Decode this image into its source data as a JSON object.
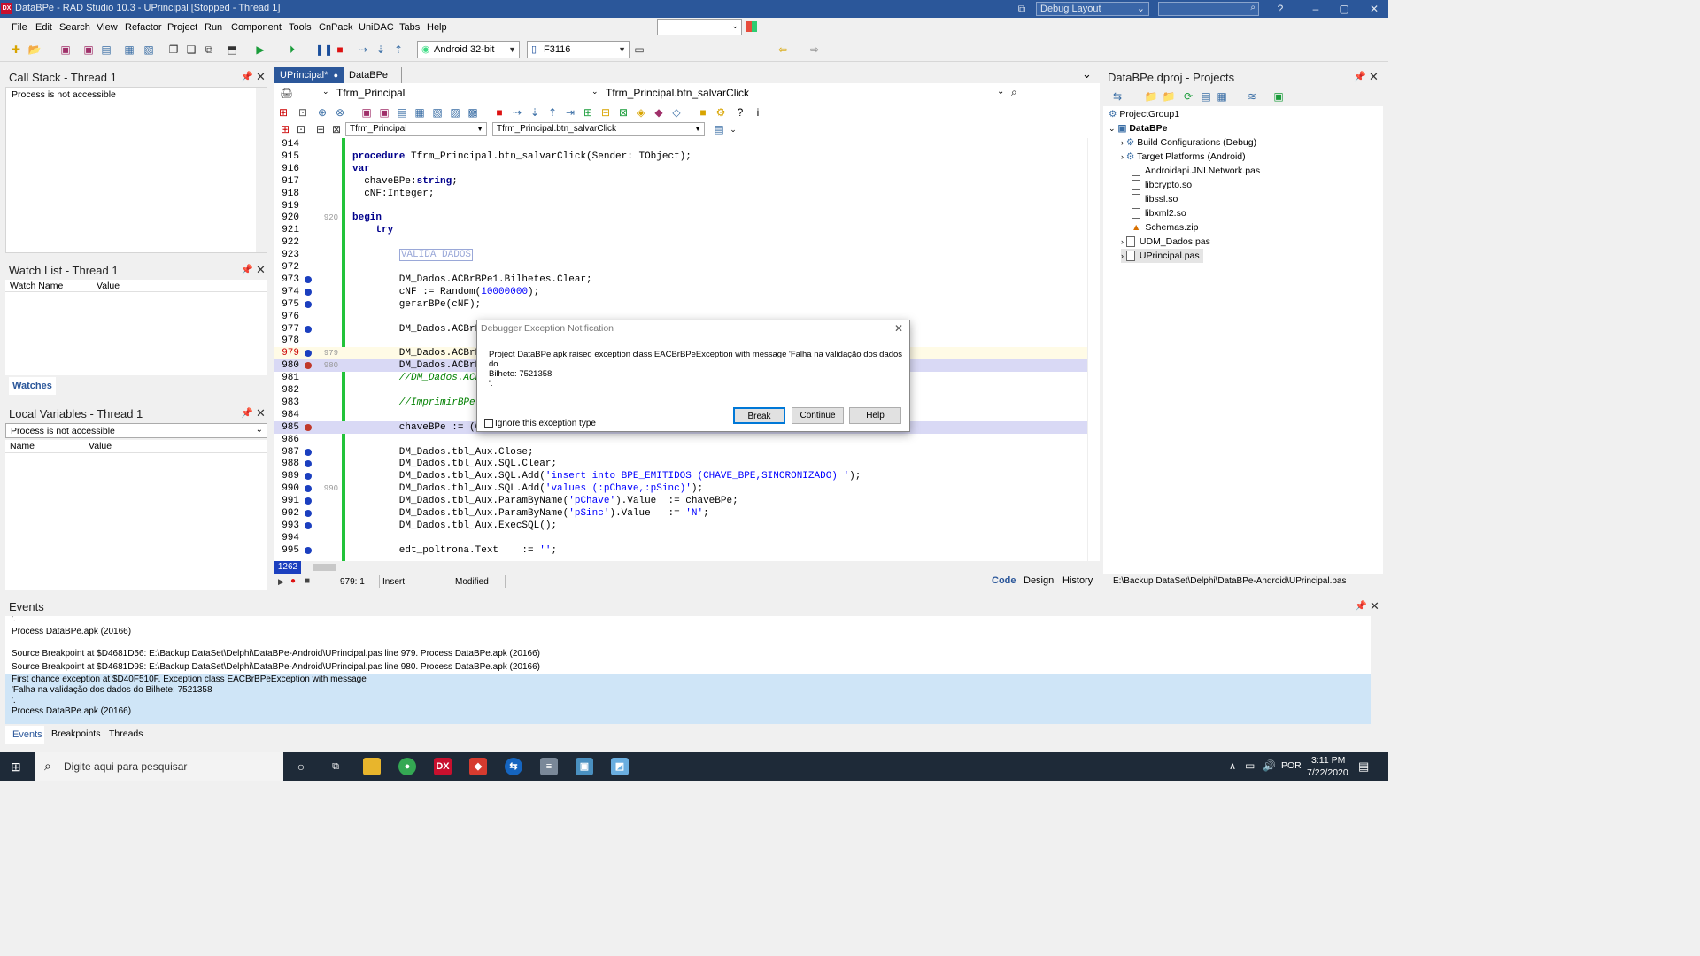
{
  "window": {
    "title": "DataBPe - RAD Studio 10.3 - UPrincipal [Stopped - Thread 1]",
    "logo": "DX",
    "layout_label": "Debug Layout"
  },
  "menu": [
    "File",
    "Edit",
    "Search",
    "View",
    "Refactor",
    "Project",
    "Run",
    "Component",
    "Tools",
    "CnPack",
    "UniDAC",
    "Tabs",
    "Help"
  ],
  "toolbar": {
    "platform": "Android 32-bit",
    "device": "F3116"
  },
  "callstack": {
    "title": "Call Stack - Thread 1",
    "message": "Process is not accessible"
  },
  "watchlist": {
    "title": "Watch List - Thread 1",
    "col_name": "Watch Name",
    "col_value": "Value",
    "tab": "Watches"
  },
  "localvars": {
    "title": "Local Variables - Thread 1",
    "dropdown": "Process is not accessible",
    "col_name": "Name",
    "col_value": "Value"
  },
  "editor": {
    "tabs": [
      "UPrincipal*",
      "DataBPe"
    ],
    "form_name": "Tfrm_Principal",
    "method_name": "Tfrm_Principal.btn_salvarClick",
    "class_combo": "Tfrm_Principal",
    "method_combo": "Tfrm_Principal.btn_salvarClick",
    "lines": [
      {
        "n": "914",
        "code": ""
      },
      {
        "n": "915",
        "code": "procedure Tfrm_Principal.btn_salvarClick(Sender: TObject);"
      },
      {
        "n": "916",
        "code": "var"
      },
      {
        "n": "917",
        "code": "  chaveBPe:string;"
      },
      {
        "n": "918",
        "code": "  cNF:Integer;"
      },
      {
        "n": "919",
        "code": ""
      },
      {
        "n": "920",
        "g": "920",
        "code": "begin"
      },
      {
        "n": "921",
        "code": "    try"
      },
      {
        "n": "922",
        "code": ""
      },
      {
        "n": "923",
        "code": "        VALIDA DADOS"
      },
      {
        "n": "972",
        "code": ""
      },
      {
        "n": "973",
        "bp": true,
        "code": "        DM_Dados.ACBrBPe1.Bilhetes.Clear;"
      },
      {
        "n": "974",
        "bp": true,
        "code": "        cNF := Random(10000000);"
      },
      {
        "n": "975",
        "bp": true,
        "code": "        gerarBPe(cNF);"
      },
      {
        "n": "976",
        "code": ""
      },
      {
        "n": "977",
        "bp": true,
        "code": "        DM_Dados.ACBrB"
      },
      {
        "n": "978",
        "code": ""
      },
      {
        "n": "979",
        "bp": true,
        "g": "979",
        "code": "        DM_Dados.ACBrB"
      },
      {
        "n": "980",
        "bp": true,
        "g": "980",
        "code": "        DM_Dados.ACBrB"
      },
      {
        "n": "981",
        "code": "        //DM_Dados.ACB"
      },
      {
        "n": "982",
        "code": ""
      },
      {
        "n": "983",
        "code": "        //ImprimirBPe("
      },
      {
        "n": "984",
        "code": ""
      },
      {
        "n": "985",
        "bp": true,
        "code": "        chaveBPe := (C"
      },
      {
        "n": "986",
        "code": ""
      },
      {
        "n": "987",
        "bp": true,
        "code": "        DM_Dados.tbl_Aux.Close;"
      },
      {
        "n": "988",
        "bp": true,
        "code": "        DM_Dados.tbl_Aux.SQL.Clear;"
      },
      {
        "n": "989",
        "bp": true,
        "code": "        DM_Dados.tbl_Aux.SQL.Add('insert into BPE_EMITIDOS (CHAVE_BPE,SINCRONIZADO) ');"
      },
      {
        "n": "990",
        "bp": true,
        "g": "990",
        "code": "        DM_Dados.tbl_Aux.SQL.Add('values (:pChave,:pSinc)');"
      },
      {
        "n": "991",
        "bp": true,
        "code": "        DM_Dados.tbl_Aux.ParamByName('pChave').Value  := chaveBPe;"
      },
      {
        "n": "992",
        "bp": true,
        "code": "        DM_Dados.tbl_Aux.ParamByName('pSinc').Value   := 'N';"
      },
      {
        "n": "993",
        "bp": true,
        "code": "        DM_Dados.tbl_Aux.ExecSQL();"
      },
      {
        "n": "994",
        "code": ""
      },
      {
        "n": "995",
        "bp": true,
        "code": "        edt_poltrona.Text    := '';"
      }
    ],
    "line_indicator": "1262",
    "status_pos": "979:  1",
    "status_mode": "Insert",
    "status_modified": "Modified",
    "view_tabs": [
      "Code",
      "Design",
      "History"
    ]
  },
  "dialog": {
    "title": "Debugger Exception Notification",
    "message_line1": "Project DataBPe.apk raised exception class EACBrBPeException with message 'Falha na validação dos dados do",
    "message_line2": "Bilhete: 7521358",
    "message_line3": "'.",
    "checkbox": "Ignore this exception type",
    "break": "Break",
    "continue": "Continue",
    "help": "Help"
  },
  "projects": {
    "title": "DataBPe.dproj - Projects",
    "items": [
      {
        "label": "ProjectGroup1",
        "level": 0
      },
      {
        "label": "DataBPe",
        "level": 0,
        "bold": true
      },
      {
        "label": "Build Configurations (Debug)",
        "level": 1
      },
      {
        "label": "Target Platforms (Android)",
        "level": 1
      },
      {
        "label": "Androidapi.JNI.Network.pas",
        "level": 1
      },
      {
        "label": "libcrypto.so",
        "level": 1
      },
      {
        "label": "libssl.so",
        "level": 1
      },
      {
        "label": "libxml2.so",
        "level": 1
      },
      {
        "label": "Schemas.zip",
        "level": 1
      },
      {
        "label": "UDM_Dados.pas",
        "level": 1
      },
      {
        "label": "UPrincipal.pas",
        "level": 1
      }
    ],
    "path": "E:\\Backup DataSet\\Delphi\\DataBPe-Android\\UPrincipal.pas"
  },
  "events": {
    "title": "Events",
    "lines": [
      "'.",
      "Process DataBPe.apk (20166)",
      "",
      "Source Breakpoint at $D4681D56: E:\\Backup DataSet\\Delphi\\DataBPe-Android\\UPrincipal.pas line 979. Process DataBPe.apk (20166)",
      "Source Breakpoint at $D4681D98: E:\\Backup DataSet\\Delphi\\DataBPe-Android\\UPrincipal.pas line 980. Process DataBPe.apk (20166)",
      "First chance exception at $D40F510F. Exception class EACBrBPeException with message",
      "'Falha na validação dos dados do Bilhete: 7521358",
      "'.",
      "Process DataBPe.apk (20166)"
    ],
    "tabs": [
      "Events",
      "Breakpoints",
      "Threads"
    ]
  },
  "taskbar": {
    "search_placeholder": "Digite aqui para pesquisar",
    "lang": "POR",
    "time": "3:11 PM",
    "date": "7/22/2020"
  }
}
